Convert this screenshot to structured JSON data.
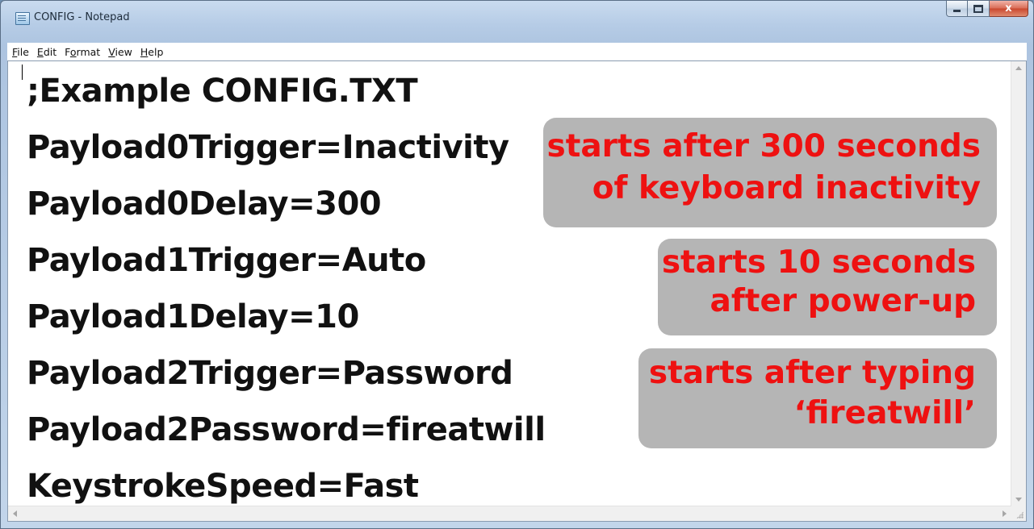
{
  "window": {
    "title": "CONFIG - Notepad",
    "controls": {
      "minimize": "minimize",
      "maximize": "maximize",
      "close": "x"
    }
  },
  "menu": [
    {
      "key": "F",
      "rest": "ile"
    },
    {
      "key": "E",
      "rest": "dit"
    },
    {
      "key": "F",
      "pre": "F",
      "label_pre": "F",
      "label_key": "o",
      "label_rest": "rmat"
    },
    {
      "key": "V",
      "rest": "iew"
    },
    {
      "key": "H",
      "rest": "elp"
    }
  ],
  "document": {
    "lines": [
      ";Example CONFIG.TXT",
      "Payload0Trigger=Inactivity",
      "Payload0Delay=300",
      "Payload1Trigger=Auto",
      "Payload1Delay=10",
      "Payload2Trigger=Password",
      "Payload2Password=fireatwill",
      "KeystrokeSpeed=Fast"
    ]
  },
  "callouts": [
    {
      "line1": "starts after 300 seconds",
      "line2": "of keyboard inactivity"
    },
    {
      "line1": "starts 10 seconds",
      "line2": "after power-up"
    },
    {
      "line1": "starts after typing",
      "line2": "‘fireatwill’"
    }
  ],
  "colors": {
    "callout_bg": "#b5b5b5",
    "callout_text": "#ee1111",
    "text": "#111111"
  }
}
